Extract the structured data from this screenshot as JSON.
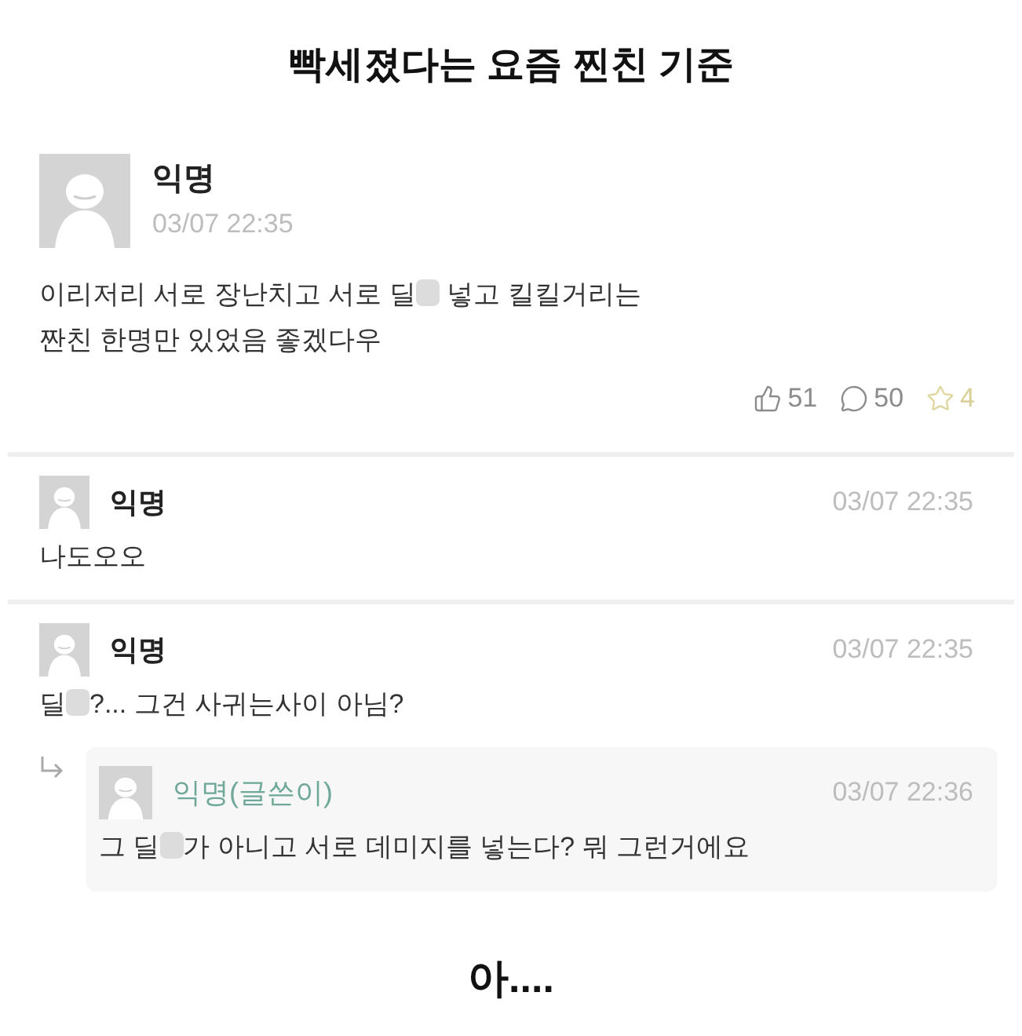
{
  "title": "빡세졌다는 요즘 찐친 기준",
  "post": {
    "author": "익명",
    "time": "03/07 22:35",
    "body": [
      [
        {
          "kind": "text",
          "text": "이리저리 서로 장난치고 서로 딜"
        },
        {
          "kind": "blur"
        },
        {
          "kind": "text",
          "text": " 넣고 킬킬거리는"
        }
      ],
      [
        {
          "kind": "text",
          "text": "짠친 한명만 있었음 좋겠다우"
        }
      ]
    ],
    "stats": [
      {
        "kind": "like",
        "count": "51"
      },
      {
        "kind": "comment",
        "count": "50"
      },
      {
        "kind": "star",
        "count": "4"
      }
    ]
  },
  "comments": [
    {
      "author": "익명",
      "writer": false,
      "time": "03/07 22:35",
      "body": [
        {
          "kind": "text",
          "text": "나도오오"
        }
      ]
    },
    {
      "author": "익명",
      "writer": false,
      "time": "03/07 22:35",
      "body": [
        {
          "kind": "text",
          "text": "딜"
        },
        {
          "kind": "blur"
        },
        {
          "kind": "text",
          "text": "?... 그건 사귀는사이 아님?"
        }
      ],
      "replies": [
        {
          "author": "익명(글쓴이)",
          "writer": true,
          "time": "03/07 22:36",
          "body": [
            {
              "kind": "text",
              "text": "그 딜"
            },
            {
              "kind": "blur"
            },
            {
              "kind": "text",
              "text": "가 아니고 서로 데미지를 넣는다? 뭐 그런거에요"
            }
          ]
        }
      ]
    }
  ],
  "caption": "아...."
}
